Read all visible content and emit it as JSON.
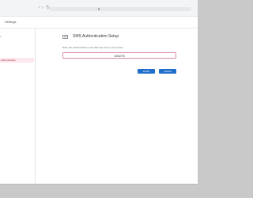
{
  "browser": {
    "nav_arrows": "‹ ›",
    "reload_icon": "reload-icon"
  },
  "header": {
    "title": "Settings"
  },
  "sidebar": {
    "top_label": "s",
    "active_item": "Authentication"
  },
  "panel": {
    "icon": "sms-message-icon",
    "title": "SMS Authentication Setup",
    "instructions": "Enter the authentication code that was sent to your phone.",
    "code_value": "349275",
    "finish_label": "Finish",
    "cancel_label": "Cancel"
  },
  "colors": {
    "accent": "#1f6fcb",
    "active_item_bg": "#fbe7ec",
    "active_item_text": "#b0354f"
  }
}
